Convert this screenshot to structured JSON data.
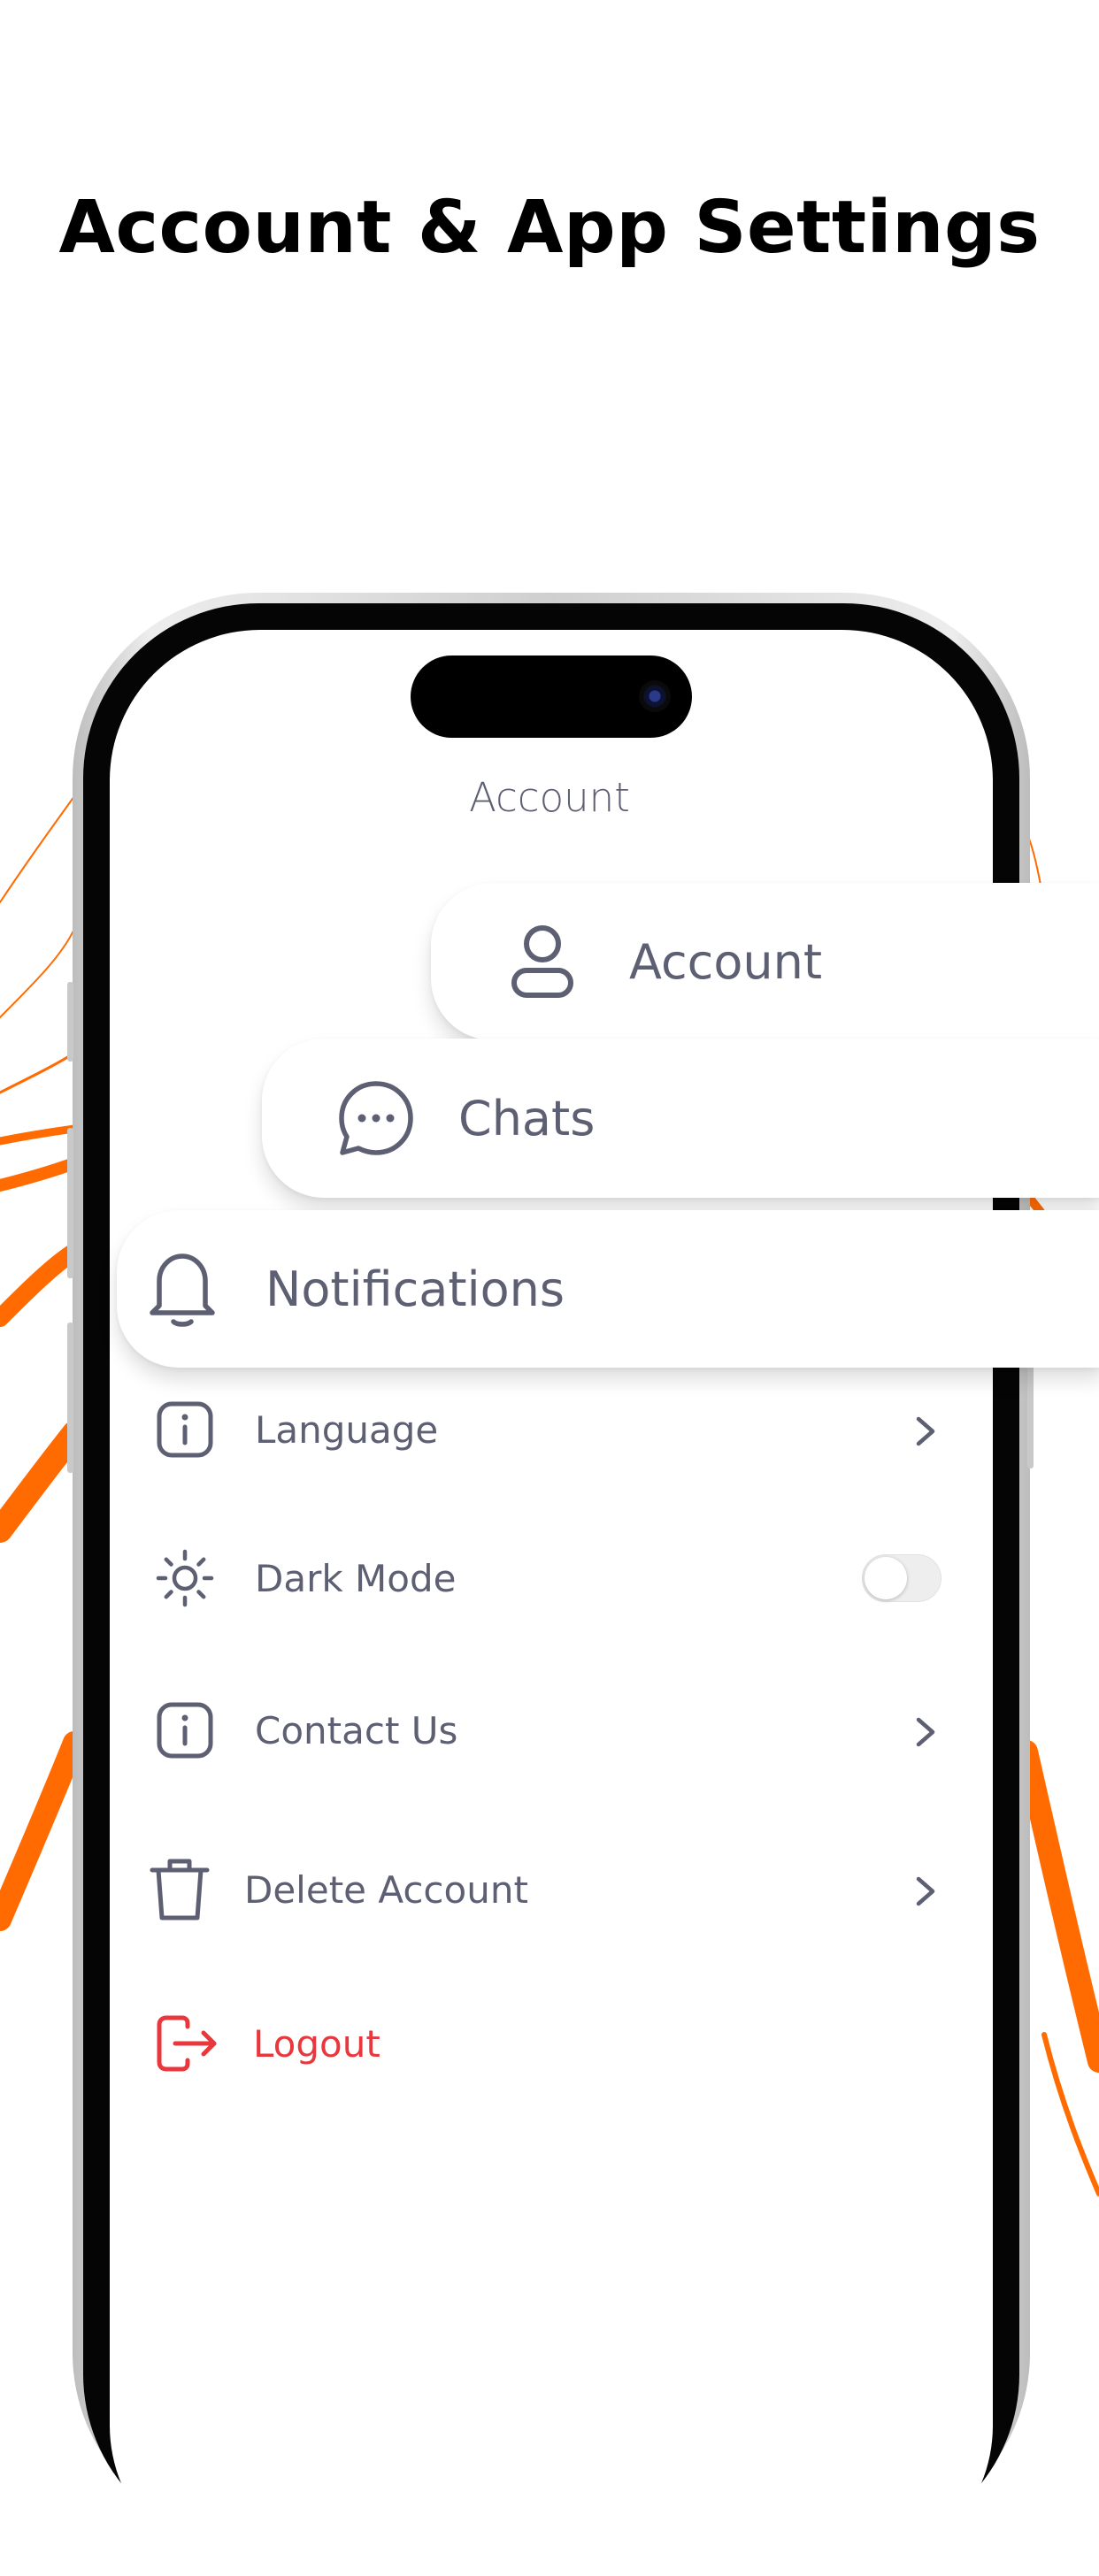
{
  "headline": "Account & App Settings",
  "screen": {
    "title": "Account",
    "cards": {
      "account": {
        "label": "Account",
        "icon": "user-icon"
      },
      "chats": {
        "label": "Chats",
        "icon": "chat-bubble-icon"
      },
      "notifications": {
        "label": "Notifications",
        "icon": "bell-icon"
      }
    },
    "rows": {
      "language": {
        "label": "Language",
        "icon": "info-icon"
      },
      "dark_mode": {
        "label": "Dark Mode",
        "icon": "sun-icon",
        "toggle_on": false
      },
      "contact_us": {
        "label": "Contact Us",
        "icon": "info-icon"
      },
      "delete_account": {
        "label": "Delete Account",
        "icon": "trash-icon"
      },
      "logout": {
        "label": "Logout",
        "icon": "logout-icon"
      }
    }
  },
  "colors": {
    "accent_orange": "#FF6B00",
    "text_gray": "#5D5F72",
    "logout_red": "#E8383D",
    "headline": "#000000"
  }
}
